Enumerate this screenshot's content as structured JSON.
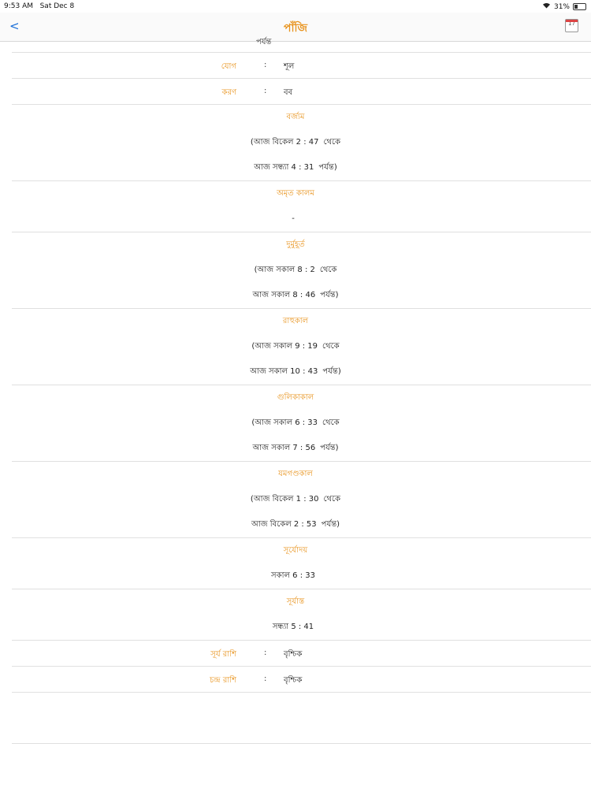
{
  "status_bar": {
    "time": "9:53 AM",
    "date": "Sat Dec 8",
    "battery": "31%",
    "battery_level": 0.31
  },
  "nav": {
    "back_label": "<",
    "title": "পাঁজি",
    "calendar_label": "17"
  },
  "partial_row": "পর্যন্ত",
  "kv_top": [
    {
      "label": "যোগ",
      "colon": ":",
      "value": "শূল"
    },
    {
      "label": "করণ",
      "colon": ":",
      "value": "বব"
    }
  ],
  "sections": [
    {
      "title": "বর্জ্যম",
      "lines": [
        {
          "text": "(আজ বিকেল 2 : 47",
          "tail": "থেকে"
        },
        {
          "text": "আজ সন্ধ্যা 4 : 31",
          "tail": "পর্যন্ত)"
        }
      ]
    },
    {
      "title": "অমৃত কালম",
      "lines": [
        {
          "text": "-",
          "tail": ""
        }
      ]
    },
    {
      "title": "দুর্মুহূর্ত",
      "lines": [
        {
          "text": "(আজ সকাল 8 : 2",
          "tail": "থেকে"
        },
        {
          "text": "আজ সকাল 8 : 46",
          "tail": "পর্যন্ত)"
        }
      ]
    },
    {
      "title": "রাহুকাল",
      "lines": [
        {
          "text": "(আজ সকাল 9 : 19",
          "tail": "থেকে"
        },
        {
          "text": "আজ সকাল 10 : 43",
          "tail": "পর্যন্ত)"
        }
      ]
    },
    {
      "title": "গুলিকাকাল",
      "lines": [
        {
          "text": "(আজ সকাল 6 : 33",
          "tail": "থেকে"
        },
        {
          "text": "আজ সকাল 7 : 56",
          "tail": "পর্যন্ত)"
        }
      ]
    },
    {
      "title": "যমগণ্ডকাল",
      "lines": [
        {
          "text": "(আজ বিকেল 1 : 30",
          "tail": "থেকে"
        },
        {
          "text": "আজ বিকেল 2 : 53",
          "tail": "পর্যন্ত)"
        }
      ]
    },
    {
      "title": "সূর্যোদয়",
      "lines": [
        {
          "text": "সকাল 6 : 33",
          "tail": ""
        }
      ]
    },
    {
      "title": "সূর্যাস্ত",
      "lines": [
        {
          "text": "সন্ধ্যা 5 : 41",
          "tail": ""
        }
      ]
    }
  ],
  "kv_bottom": [
    {
      "label": "সূর্য রাশি",
      "colon": ":",
      "value": "বৃশ্চিক"
    },
    {
      "label": "চন্দ্র রাশি",
      "colon": ":",
      "value": "বৃশ্চিক"
    }
  ]
}
